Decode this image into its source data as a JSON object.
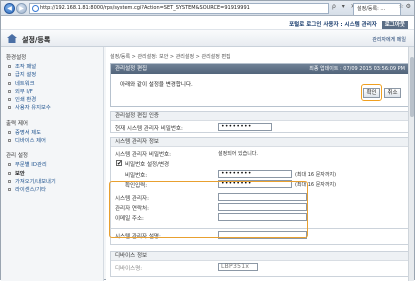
{
  "browser": {
    "url": "http://192.168.1.81:8000/rps/system.cgi?Action=SET_SYSTEM&SOURCE=91919991",
    "tab_title": "설정/등록: ...",
    "back": "◀",
    "forward": "▶",
    "url_icons": "ρ ▾ ✕ ⟳",
    "window_controls": "☆ ⚙"
  },
  "top_links": {
    "portal": "포털로",
    "user": "로그인 사용자 : 시스템 관리자",
    "logout": "로그아웃"
  },
  "page": {
    "title": "설정/등록",
    "manager_mail": "관리자에게 메일"
  },
  "sidebar": {
    "groups": [
      {
        "heading": "환경설정",
        "items": [
          "조작 패널",
          "급지 설정",
          "네트워크",
          "외부 I/F",
          "인쇄 환경",
          "사용자 유지보수"
        ]
      },
      {
        "heading": "출력 제어",
        "items": [
          "증명서 제도",
          "디바이스 제어"
        ]
      },
      {
        "heading": "관리 설정",
        "items": [
          "부문별 ID관리",
          "보안",
          "가져오기/내보내기",
          "라이센스/기타"
        ]
      }
    ]
  },
  "main": {
    "breadcrumb": "설정/등록 > 관리설정: 보안 > 관리설정 > 관리설정 편집",
    "panel_title": "관리설정 편집",
    "last_updated": "최종 업데이트 : 07/09 2015 03:56:09 PM",
    "message": "아래와 같이 설정을 변경합니다.",
    "ok_label": "확인",
    "cancel_label": "취소",
    "section1": {
      "title": "관리설정 편집 인증",
      "label": "현재 시스템 관리자 비밀번호:",
      "value": "••••••••"
    },
    "section2": {
      "title": "시스템 관리자 정보",
      "id_label": "시스템 관리자 비밀번호:",
      "id_value": "설정되어 있습니다.",
      "check_label": "비밀번호 설정/변경",
      "pw_label": "비밀번호:",
      "pw_value": "••••••••",
      "pw_note": "(최대 16 문자까지)",
      "confirm_label": "확인입력:",
      "confirm_value": "••••••••",
      "confirm_note": "(최대 16 문자까지)"
    },
    "fields": [
      {
        "label": "시스템 관리자:"
      },
      {
        "label": "관리자 연락처:"
      },
      {
        "label": "이메일 주소:"
      },
      {
        "label": "시스템 관리자 설명:"
      }
    ],
    "section3": {
      "title": "디바이스 정보",
      "label": "디바이스명:",
      "value": "LBP351x"
    }
  }
}
